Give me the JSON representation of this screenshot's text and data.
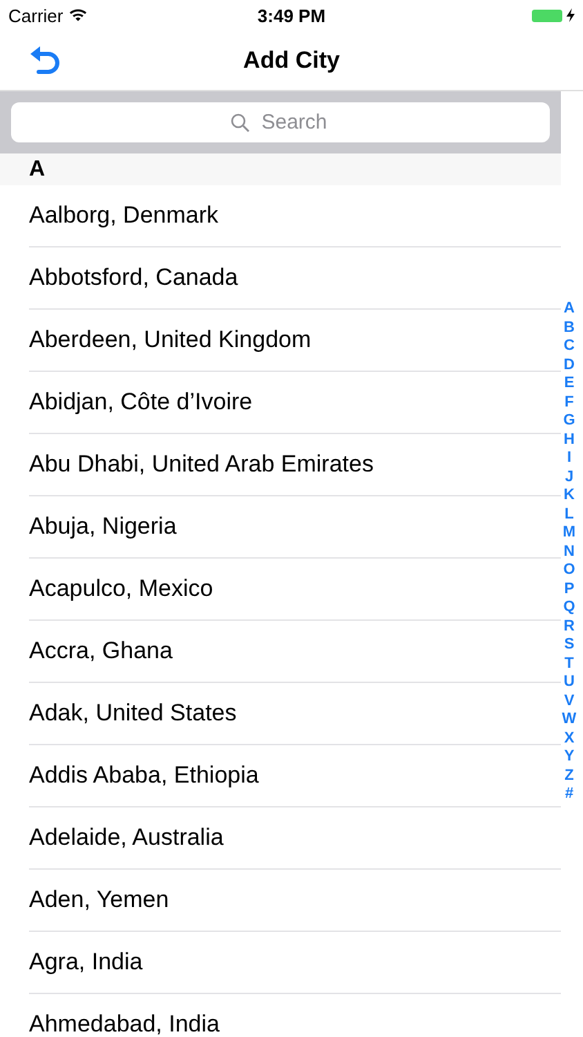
{
  "status_bar": {
    "carrier": "Carrier",
    "time": "3:49 PM",
    "charging": true
  },
  "nav_bar": {
    "title": "Add City"
  },
  "search": {
    "placeholder": "Search"
  },
  "section": {
    "header": "A",
    "rows": [
      "Aalborg, Denmark",
      "Abbotsford, Canada",
      "Aberdeen, United Kingdom",
      "Abidjan, Côte d’Ivoire",
      "Abu Dhabi, United Arab Emirates",
      "Abuja, Nigeria",
      "Acapulco, Mexico",
      "Accra, Ghana",
      "Adak, United States",
      "Addis Ababa, Ethiopia",
      "Adelaide, Australia",
      "Aden, Yemen",
      "Agra, India",
      "Ahmedabad, India"
    ]
  },
  "index": [
    "A",
    "B",
    "C",
    "D",
    "E",
    "F",
    "G",
    "H",
    "I",
    "J",
    "K",
    "L",
    "M",
    "N",
    "O",
    "P",
    "Q",
    "R",
    "S",
    "T",
    "U",
    "V",
    "W",
    "X",
    "Y",
    "Z",
    "#"
  ]
}
